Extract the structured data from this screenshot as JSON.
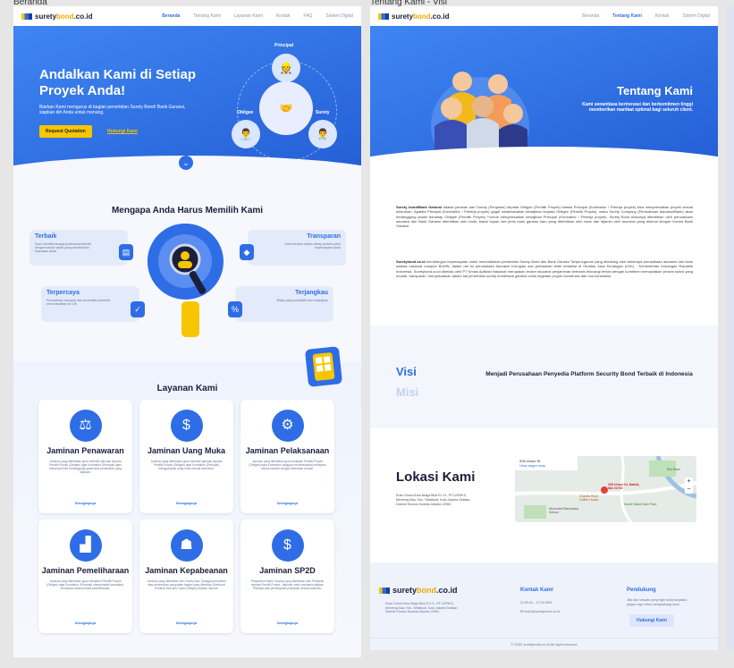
{
  "captions": {
    "left": "Beranda",
    "right": "Tentang Kami - Visi"
  },
  "logo": {
    "a": "surety",
    "b": "bond",
    "c": ".co.id"
  },
  "home": {
    "nav": [
      "Beranda",
      "Tentang Kami",
      "Layanan Kami",
      "Kontak",
      "FAQ",
      "Sistem Digital"
    ],
    "hero": {
      "title": "Andalkan Kami di Setiap Proyek Anda!",
      "desc": "Biarkan Kami mengurus di bagian penerbitan Surety Bond/ Bank Garansi, siapkan diri Anda untuk menang.",
      "cta": "Request Quotation",
      "link": "Hubungi Kami",
      "principal": "Principal",
      "obligee": "Obligee",
      "surety": "Surety"
    },
    "why": {
      "title": "Mengapa Anda Harus Memilih Kami",
      "items": [
        {
          "title": "Terbaik",
          "desc": "Kami memiliki tenaga profesional terbaik dengan sekali rukadi yang memberikan kepuasan Anda"
        },
        {
          "title": "Transparan",
          "desc": "Kami terbuka dalam setiap proses untuk kepercayaan Anda"
        },
        {
          "title": "Terpercaya",
          "desc": "Perusahaan asuransi dan penerbitan penerbit resmi terdaftar di OJK"
        },
        {
          "title": "Terjangkau",
          "desc": "Biaya yang kompetitif dan terjangkau"
        }
      ]
    },
    "services": {
      "title": "Layanan Kami",
      "more": "Selengkapnya",
      "items": [
        {
          "title": "Jaminan Penawaran",
          "desc": "Jaminan yang diterbitkan guna memberi jaminan kepada Pemilik Proyek (Obligee) agar Kontraktor (Principal) akan menang tender bertanggung jawab atas penawaran yang diajukan."
        },
        {
          "title": "Jaminan Uang Muka",
          "desc": "Jaminan yang diterbitkan guna memberi jaminan kepada Pemilik Proyek (Obligee) agar Kontraktor (Principal) menggunakan uang muka sesuai ketentuan."
        },
        {
          "title": "Jaminan Pelaksanaan",
          "desc": "Jaminan yang diterbitkan guna melayani Pemilik Proyek (Obligee) agar Kontraktor sanggup menyelesaikan pekerjaan sesuai kontrak dengan ketentuan di awal."
        },
        {
          "title": "Jaminan Pemeliharaan",
          "desc": "Jaminan yang diterbitkan guna menjamin Pemilik Proyek (Obligee) agar Kontraktor (Principal) memperbaiki kerusakan-kerusakan selama masa pemeliharaan."
        },
        {
          "title": "Jaminan Kepabeanan",
          "desc": "Jaminan yang diterbitkan oleh Surety Aba. Sebagai penerbitan atas pemenuhan penguatan bagian yang diberikan Direktorat Jenderal Bea dan Cukai (Obligee) kepada Importir."
        },
        {
          "title": "Jaminan SP2D",
          "desc": "Penjaminan Bank Garansi yang diterbitkan oleh Penjamin kepada Pemilik Proyek. Jaminan untuk menjamin tagihan Principal atas pembayaran pekerjaan sesuai dokumen."
        }
      ]
    }
  },
  "about": {
    "nav": [
      "Beranda",
      "Tentang Kami",
      "Kontak",
      "Sistem Digital"
    ],
    "hero": {
      "title": "Tentang Kami",
      "desc": "Kami senantiasa berinovasi dan berkomitmen tinggi memberikan manfaat optimal bagi seluruh client."
    },
    "p1_b": "Surety bond/Bank Garansi",
    "p1": " adalah jaminan dari Surety (Penjamin) kepada Obligee (Pemilik Proyek) bahwa Principal (Kontraktor / Pekerja proyek) bisa menyelesaikan proyek sesuai ketentuan. Apabila Principal (Kontraktor / Pekerja proyek) gagal melaksanakan kewajiban kepada Obligee (Pemilik Proyek), maka Surety Company (Perusahaan Asuransi/Bank) akan bertanggung jawab terhadap Obligee (Pemilik Proyek) **untuk menyelesaikan kewajiban Principal (Kontraktor / Pekerja proyek). Surety Bond biasanya diterbitkan oleh perusahaan asuransi dan Bank Garansi diterbitkan oleh bank, ibarat tujuan dan jenis bank garansi baru yang diterbitkan oleh bank dan dijamin oleh asuransi yang dikenal dengan Kontra Bank Garansi.",
    "p2_b": "Suretybond.co.id",
    "p2": " membangun kepercayaan untuk memudahkan penerbitan Surety Bond dan Bank Garansi Tanpa Agunan yang didukung oleh beberapa perusahaan asuransi dan bank swasta nasional maupun BUMN, dalam hal ini perusahaan Asuransi Kerugian dan perbankan telah terdaftar di Otoritas Jasa Keuangan (OJK) - Kementerian Keuangan Republik Indonesia. Suretybond.co.id dikelola oleh PT Kreasi Aplikasi Nasional merupakan broker asuransi penjaminan berbasis teknologi terkini dengan komitmen menciptakan proses solusi yang mudah, transparan, menyesuaikan dalam hal penerbitan surety bond/bank garansi untuk kegiatan proyek konstruksi dan non konstruksi.",
    "visi": "Visi",
    "misi": "Misi",
    "visi_text": "Menjadi Perusahaan Penyedia Platform Security Bond Terbaik di Indonesia",
    "loc_title": "Lokasi Kami",
    "loc_addr": "Ruko Grand Area Niaga Blok E1-21, RT.12/RW.5, Menteng Atas, Kec. Setiabudi, Kota Jakarta Selatan, Daerah Khusus Ibukota Jakarta 12960.",
    "map": {
      "place": "205 Union St",
      "view": "View larger map",
      "pin": "205 Union St, Natick, MA 01760",
      "p1": "Charles River Coffee House",
      "p2": "South Natick Dam Park",
      "p3": "Memorial Elementary School",
      "p4": "Elm Bank"
    },
    "footer": {
      "addr": "Ruko Grand Area Niaga Blok E1-21, RT.12/RW.5, Menteng Atas, Kec. Setiabudi, Kota Jakarta Selatan, Daerah Khusus Ibukota Jakarta 12960.",
      "contact_title": "Kontak Kami",
      "hours": "08.00 - 17.00 WIB",
      "email": "hello@suretybond.co.id",
      "support_title": "Pendukung",
      "support_desc": "Jika ada sesuatu yang ingin Anda tanyakan, jangan ragu untuk menghubungi kami",
      "support_btn": "Hubungi Kami",
      "copy": "© 2022 suretybond.co.id All right reserved"
    }
  }
}
